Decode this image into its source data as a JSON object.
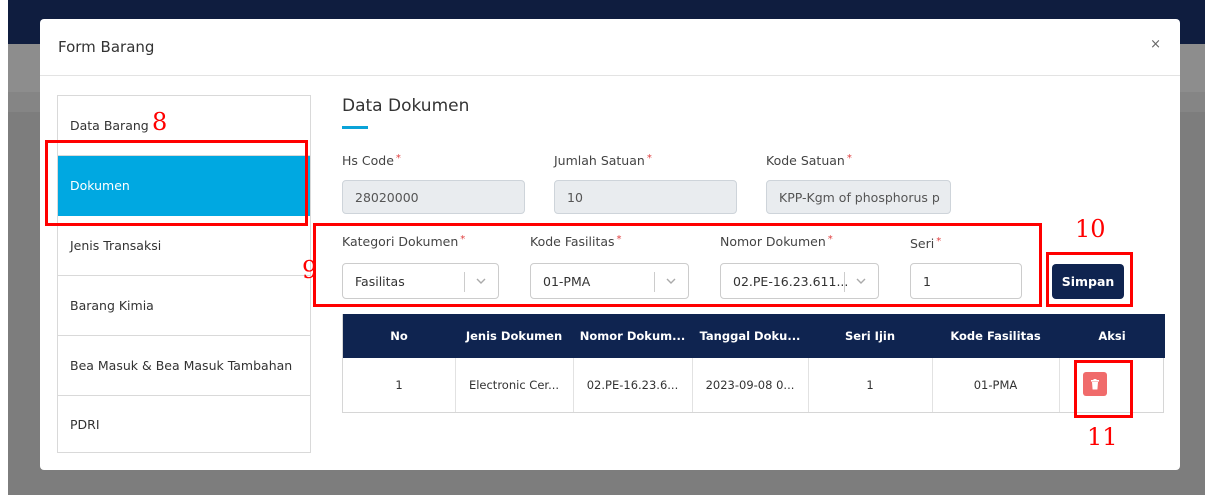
{
  "modal": {
    "title": "Form Barang",
    "close_label": "×"
  },
  "sidebar": {
    "items": [
      {
        "label": "Data Barang"
      },
      {
        "label": "Dokumen"
      },
      {
        "label": "Jenis Transaksi"
      },
      {
        "label": "Barang Kimia"
      },
      {
        "label": "Bea Masuk & Bea Masuk Tambahan"
      },
      {
        "label": "PDRI"
      }
    ],
    "active": "Dokumen"
  },
  "section": {
    "title": "Data Dokumen"
  },
  "fields": {
    "hs_code": {
      "label": "Hs Code",
      "value": "28020000"
    },
    "jumlah_satuan": {
      "label": "Jumlah Satuan",
      "value": "10"
    },
    "kode_satuan": {
      "label": "Kode Satuan",
      "value": "KPP-Kgm of phosphorus p"
    },
    "kategori_dokumen": {
      "label": "Kategori Dokumen",
      "value": "Fasilitas"
    },
    "kode_fasilitas": {
      "label": "Kode Fasilitas",
      "value": "01-PMA"
    },
    "nomor_dokumen": {
      "label": "Nomor Dokumen",
      "value": "02.PE-16.23.611..."
    },
    "seri": {
      "label": "Seri",
      "value": "1"
    },
    "required_mark": "*"
  },
  "actions": {
    "save_label": "Simpan"
  },
  "table": {
    "headers": [
      "No",
      "Jenis Dokumen",
      "Nomor Dokum...",
      "Tanggal Doku...",
      "Seri Ijin",
      "Kode Fasilitas",
      "Aksi"
    ],
    "rows": [
      [
        "1",
        "Electronic Cer...",
        "02.PE-16.23.6...",
        "2023-09-08 0...",
        "1",
        "01-PMA"
      ]
    ]
  },
  "annotations": {
    "a8": "8",
    "a9": "9",
    "a10": "10",
    "a11": "11"
  },
  "colors": {
    "accent": "#00a8e1",
    "navy": "#0f2450",
    "danger": "#f06b6b",
    "annotation": "#ff0000"
  }
}
